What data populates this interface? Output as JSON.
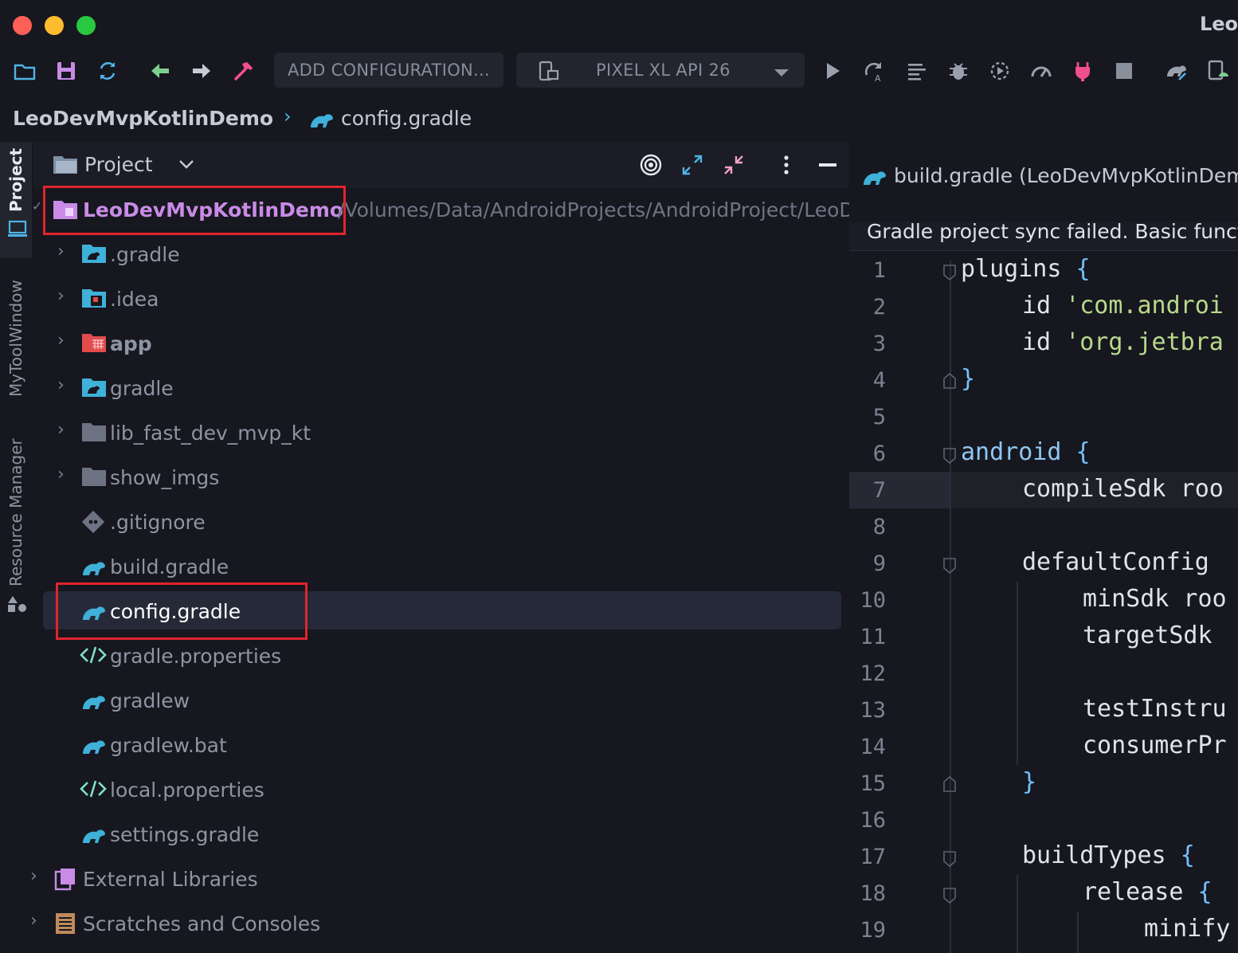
{
  "window": {
    "title": "Leo"
  },
  "toolbar": {
    "add_configuration": "ADD CONFIGURATION...",
    "device": "PIXEL XL API 26"
  },
  "breadcrumb": {
    "project": "LeoDevMvpKotlinDemo",
    "file": "config.gradle"
  },
  "left_strip": {
    "tabs": [
      "Project",
      "MyToolWindow",
      "Resource Manager"
    ]
  },
  "project_panel": {
    "title": "Project",
    "root": {
      "name": "LeoDevMvpKotlinDemo",
      "path": "/Volumes/Data/AndroidProjects/AndroidProject/LeoDevMvpKotlinDemo"
    },
    "items": [
      {
        "label": ".gradle",
        "icon": "gradle-folder-icon",
        "expandable": true
      },
      {
        "label": ".idea",
        "icon": "idea-folder-icon",
        "expandable": true
      },
      {
        "label": "app",
        "icon": "module-folder-icon",
        "expandable": true
      },
      {
        "label": "gradle",
        "icon": "gradle-folder-icon",
        "expandable": true
      },
      {
        "label": "lib_fast_dev_mvp_kt",
        "icon": "folder-icon",
        "expandable": true
      },
      {
        "label": "show_imgs",
        "icon": "folder-icon",
        "expandable": true
      },
      {
        "label": ".gitignore",
        "icon": "git-file-icon",
        "expandable": false
      },
      {
        "label": "build.gradle",
        "icon": "gradle-file-icon",
        "expandable": false
      },
      {
        "label": "config.gradle",
        "icon": "gradle-file-icon",
        "expandable": false,
        "selected": true
      },
      {
        "label": "gradle.properties",
        "icon": "properties-file-icon",
        "expandable": false
      },
      {
        "label": "gradlew",
        "icon": "gradle-file-icon",
        "expandable": false
      },
      {
        "label": "gradlew.bat",
        "icon": "gradle-file-icon",
        "expandable": false
      },
      {
        "label": "local.properties",
        "icon": "properties-file-icon",
        "expandable": false
      },
      {
        "label": "settings.gradle",
        "icon": "gradle-file-icon",
        "expandable": false
      }
    ],
    "external_libraries": "External Libraries",
    "scratches": "Scratches and Consoles"
  },
  "editor": {
    "tab_label": "build.gradle (LeoDevMvpKotlinDem",
    "notification": "Gradle project sync failed. Basic funct",
    "line_numbers": [
      "1",
      "2",
      "3",
      "4",
      "5",
      "6",
      "7",
      "8",
      "9",
      "10",
      "11",
      "12",
      "13",
      "14",
      "15",
      "16",
      "17",
      "18",
      "19"
    ],
    "code": {
      "l1_kw": "plugins",
      "l1_brace": "{",
      "l2_id": "id",
      "l2_str": "'com.androi",
      "l3_id": "id",
      "l3_str": "'org.jetbra",
      "l4_brace": "}",
      "l6_kw": "android",
      "l6_brace": "{",
      "l7": "compileSdk roo",
      "l9": "defaultConfig",
      "l10": "minSdk roo",
      "l11": "targetSdk",
      "l13": "testInstru",
      "l14": "consumerPr",
      "l15_brace": "}",
      "l17": "buildTypes",
      "l17_brace": "{",
      "l18": "release",
      "l18_brace": "{",
      "l19": "minify"
    }
  },
  "colors": {
    "background": "#16171f",
    "selection": "#262a38",
    "highlight_red": "#e0242c",
    "gradle_blue": "#3fb0d8",
    "accent_purple": "#c98be6"
  }
}
